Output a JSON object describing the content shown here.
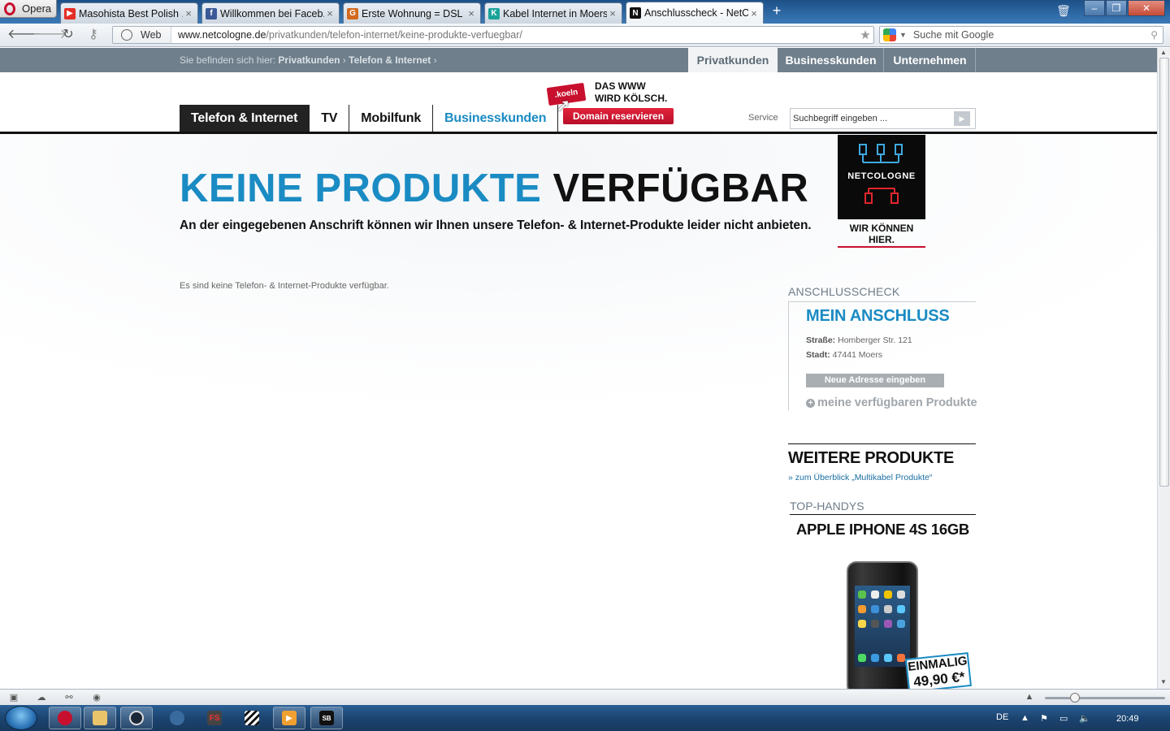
{
  "browser": {
    "menu_label": "Opera",
    "tabs": [
      {
        "title": "Masohista Best Polish ...",
        "favicon_color": "#e52d27",
        "favicon_glyph": "▶",
        "active": false
      },
      {
        "title": "Willkommen bei Faceb...",
        "favicon_color": "#3b5998",
        "favicon_glyph": "f",
        "active": false
      },
      {
        "title": "Erste Wohnung = DSL ...",
        "favicon_color": "#d2691e",
        "favicon_glyph": "G",
        "active": false
      },
      {
        "title": "Kabel Internet in Moers...",
        "favicon_color": "#1aa39b",
        "favicon_glyph": "K",
        "active": false
      },
      {
        "title": "Anschlusscheck - NetC...",
        "favicon_color": "#111111",
        "favicon_glyph": "N",
        "active": true
      }
    ],
    "new_tab_label": "+",
    "address": {
      "mode_label": "Web",
      "url_domain": "www.netcologne.de",
      "url_path": "/privatkunden/telefon-internet/keine-produkte-verfuegbar/"
    },
    "search": {
      "placeholder": "Suche mit Google"
    },
    "zoom_level": 0.25
  },
  "site": {
    "breadcrumb_prefix": "Sie befinden sich hier:",
    "breadcrumb_items": [
      "Privatkunden",
      "Telefon & Internet"
    ],
    "segment_tabs": [
      {
        "label": "Privatkunden",
        "active": true
      },
      {
        "label": "Businesskunden",
        "active": false
      },
      {
        "label": "Unternehmen",
        "active": false
      }
    ],
    "main_nav": [
      {
        "label": "Telefon & Internet",
        "active": true
      },
      {
        "label": "TV",
        "active": false
      },
      {
        "label": "Mobilfunk",
        "active": false
      },
      {
        "label": "Businesskunden",
        "active": false
      }
    ],
    "promo": {
      "badge": ".koeln",
      "line1": "DAS WWW",
      "line2": "WIRD KÖLSCH.",
      "button": "Domain reservieren"
    },
    "service_label": "Service",
    "site_search_placeholder": "Suchbegriff eingeben ...",
    "headline_blue": "KEINE PRODUKTE",
    "headline_black": "VERFÜGBAR",
    "subline": "An der eingegebenen Anschrift können wir Ihnen unsere Telefon- & Internet-Produkte leider nicht anbieten.",
    "info_text": "Es sind keine Telefon- & Internet-Produkte verfügbar.",
    "logo": {
      "name": "NETCOLOGNE",
      "tagline": "WIR KÖNNEN HIER."
    },
    "anschlusscheck": {
      "label": "ANSCHLUSSCHECK",
      "title": "MEIN ANSCHLUSS",
      "street_label": "Straße:",
      "street_value": "Homberger Str. 121",
      "city_label": "Stadt:",
      "city_value": "47441 Moers",
      "button": "Neue Adresse eingeben",
      "products_link": "meine verfügbaren Produkte"
    },
    "weitere": {
      "title": "WEITERE PRODUKTE",
      "link": "» zum Überblick „Multikabel Produkte“"
    },
    "top_handys": {
      "label": "TOP-HANDYS",
      "product": "APPLE IPHONE 4S 16GB",
      "price_line1": "EINMALIG",
      "price_line2": "49,90 €*"
    }
  },
  "taskbar": {
    "items": [
      "Opera",
      "Explorer",
      "Steam",
      "TeamSpeak",
      "FS",
      "Clapper",
      "Media",
      "SB"
    ],
    "language": "DE",
    "clock": "20:49"
  },
  "colors": {
    "brand_blue": "#1a8bc3",
    "brand_red": "#c8102e",
    "strip_gray": "#6f7f8c"
  }
}
